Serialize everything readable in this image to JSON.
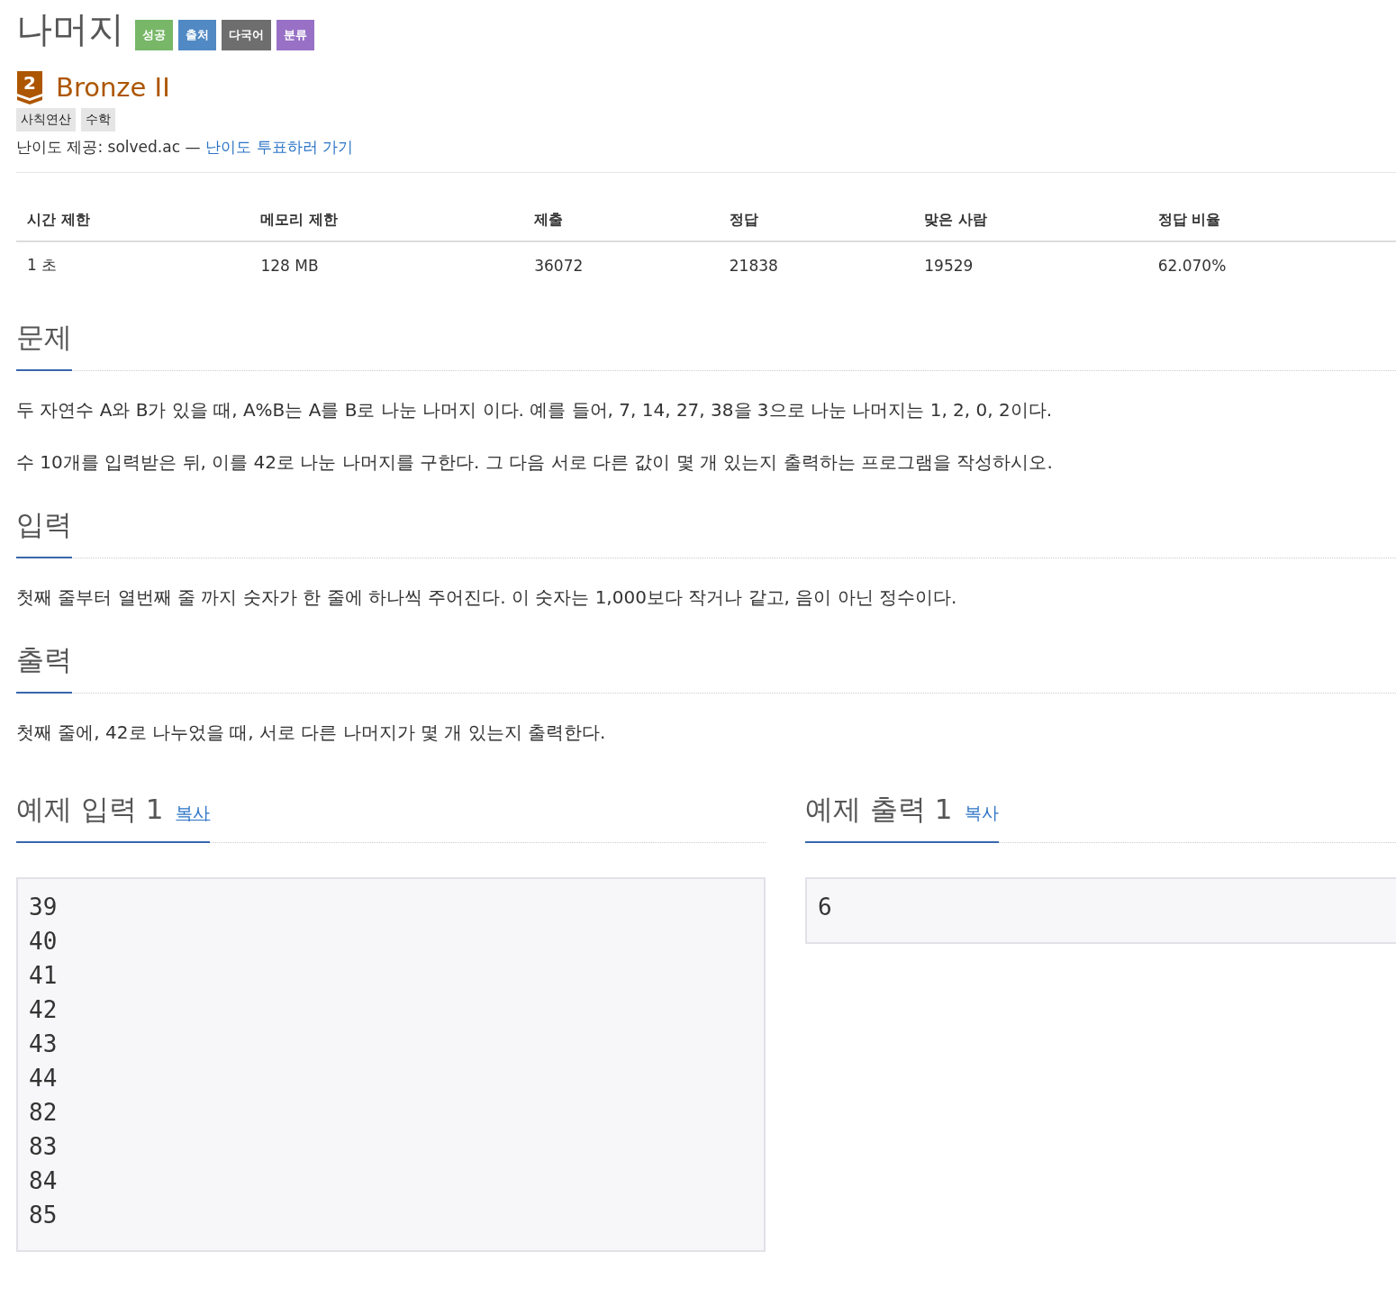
{
  "title": "나머지",
  "badges": [
    {
      "label": "성공",
      "color": "#77b767"
    },
    {
      "label": "출처",
      "color": "#5189c4"
    },
    {
      "label": "다국어",
      "color": "#6e6e6e"
    },
    {
      "label": "분류",
      "color": "#9871c6"
    }
  ],
  "tier": {
    "number": "2",
    "name": "Bronze II"
  },
  "tags": [
    "사칙연산",
    "수학"
  ],
  "difficulty": {
    "text": "난이도 제공: solved.ac —",
    "link": "난이도 투표하러 가기"
  },
  "table": {
    "columns": [
      "시간 제한",
      "메모리 제한",
      "제출",
      "정답",
      "맞은 사람",
      "정답 비율"
    ],
    "rows": [
      [
        "1 초",
        "128 MB",
        "36072",
        "21838",
        "19529",
        "62.070%"
      ]
    ]
  },
  "sections": [
    {
      "heading": "문제",
      "paragraphs": [
        "두 자연수 A와 B가 있을 때, A%B는 A를 B로 나눈 나머지 이다. 예를 들어, 7, 14, 27, 38을 3으로 나눈 나머지는 1, 2, 0, 2이다.",
        "수 10개를 입력받은 뒤, 이를 42로 나눈 나머지를 구한다. 그 다음 서로 다른 값이 몇 개 있는지 출력하는 프로그램을 작성하시오."
      ]
    },
    {
      "heading": "입력",
      "paragraphs": [
        "첫째 줄부터 열번째 줄 까지 숫자가 한 줄에 하나씩 주어진다. 이 숫자는 1,000보다 작거나 같고, 음이 아닌 정수이다."
      ]
    },
    {
      "heading": "출력",
      "paragraphs": [
        "첫째 줄에, 42로 나누었을 때, 서로 다른 나머지가 몇 개 있는지 출력한다."
      ]
    }
  ],
  "samples": [
    {
      "heading": "예제 입력 1",
      "copy": "복사",
      "hovered": true,
      "lines": [
        "39",
        "40",
        "41",
        "42",
        "43",
        "44",
        "82",
        "83",
        "84",
        "85"
      ]
    },
    {
      "heading": "예제 출력 1",
      "copy": "복사",
      "hovered": false,
      "lines": [
        "6"
      ]
    }
  ]
}
